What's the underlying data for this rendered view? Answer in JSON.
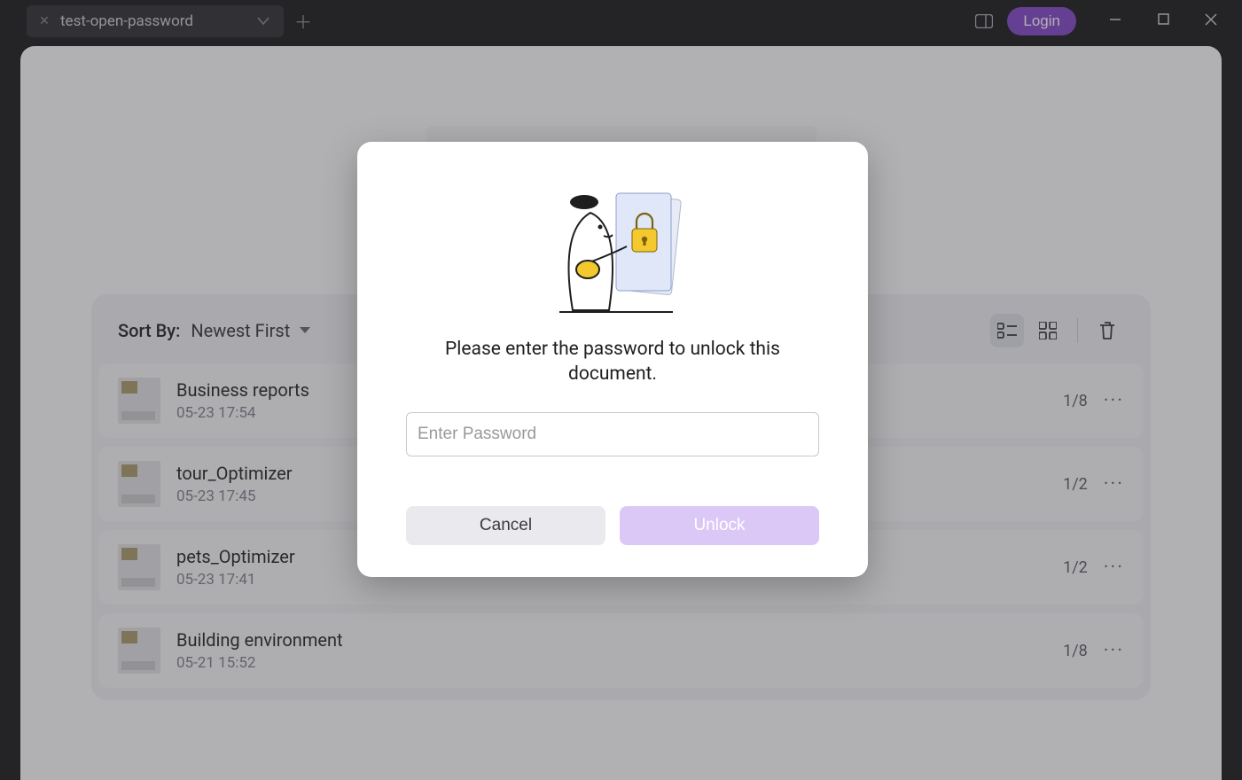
{
  "titlebar": {
    "tab_title": "test-open-password",
    "login_label": "Login"
  },
  "panel": {
    "sort_label": "Sort By:",
    "sort_value": "Newest First"
  },
  "docs": [
    {
      "title": "Business reports",
      "date": "05-23 17:54",
      "pages": "1/8"
    },
    {
      "title": "tour_Optimizer",
      "date": "05-23 17:45",
      "pages": "1/2"
    },
    {
      "title": "pets_Optimizer",
      "date": "05-23 17:41",
      "pages": "1/2"
    },
    {
      "title": "Building environment",
      "date": "05-21 15:52",
      "pages": "1/8"
    }
  ],
  "modal": {
    "message": "Please enter the password to unlock this document.",
    "placeholder": "Enter Password",
    "cancel_label": "Cancel",
    "unlock_label": "Unlock"
  }
}
